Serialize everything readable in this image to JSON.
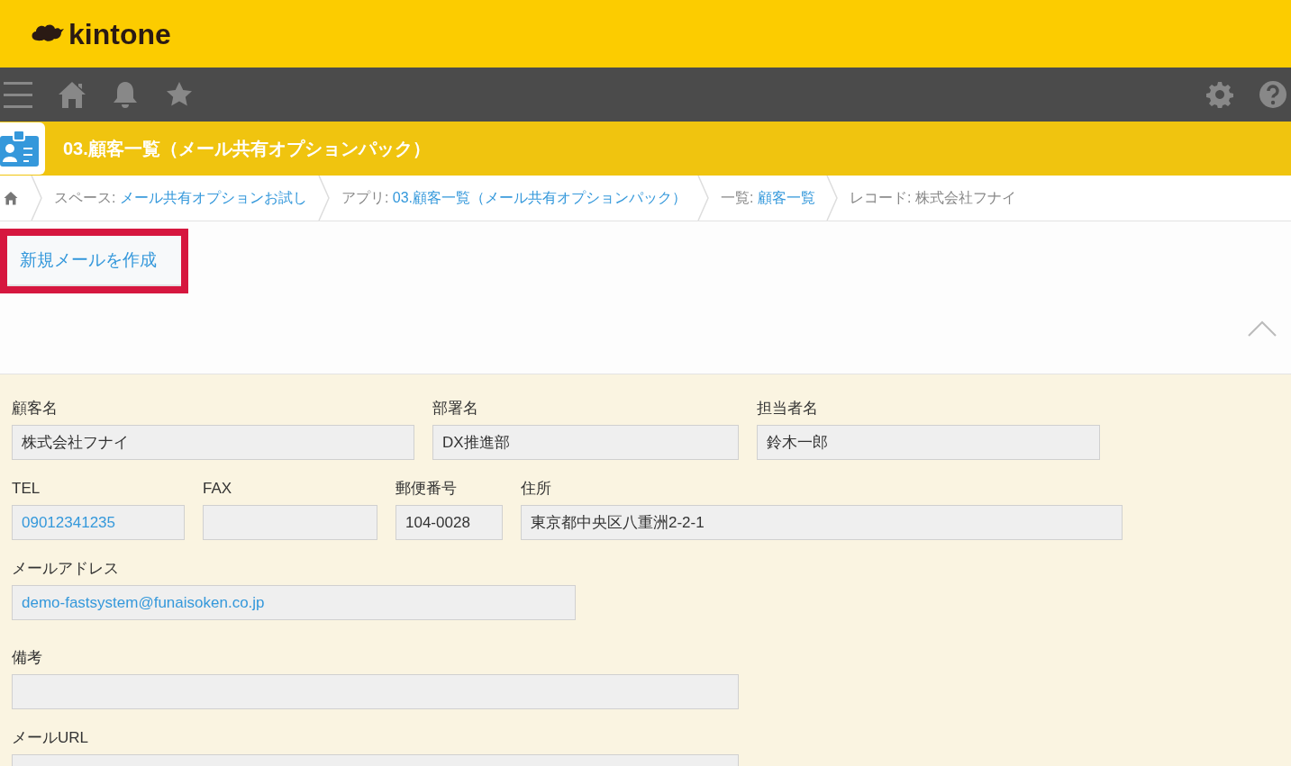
{
  "header": {
    "logo": "kintone"
  },
  "app": {
    "title": "03.顧客一覧（メール共有オプションパック）"
  },
  "breadcrumbs": [
    {
      "prefix": "スペース: ",
      "link": "メール共有オプションお試し"
    },
    {
      "prefix": "アプリ: ",
      "link": "03.顧客一覧（メール共有オプションパック）"
    },
    {
      "prefix": "一覧: ",
      "link": "顧客一覧"
    },
    {
      "prefix": "レコード: 株式会社フナイ"
    }
  ],
  "toolbar": {
    "button": "新規メールを作成",
    "highlighted": true
  },
  "form": [
    [
      {
        "label": "顧客名",
        "value": "株式会社フナイ",
        "link": false
      },
      {
        "label": "部署名",
        "value": "DX推進部",
        "link": false
      },
      {
        "label": "担当者名",
        "value": "鈴木一郎",
        "link": false
      }
    ],
    [
      {
        "label": "TEL",
        "value": "09012341235",
        "link": true
      },
      {
        "label": "FAX"
      },
      {
        "label": "郵便番号",
        "value": "104-0028",
        "link": false
      },
      {
        "label": "住所",
        "value": "東京都中央区八重洲2-2-1",
        "link": false
      }
    ],
    [
      {
        "label": "メールアドレス",
        "value": "demo-fastsystem@funaisoken.co.jp",
        "link": true
      }
    ],
    [
      {
        "label": "備考"
      }
    ],
    [
      {
        "label": "メールURL"
      }
    ]
  ]
}
